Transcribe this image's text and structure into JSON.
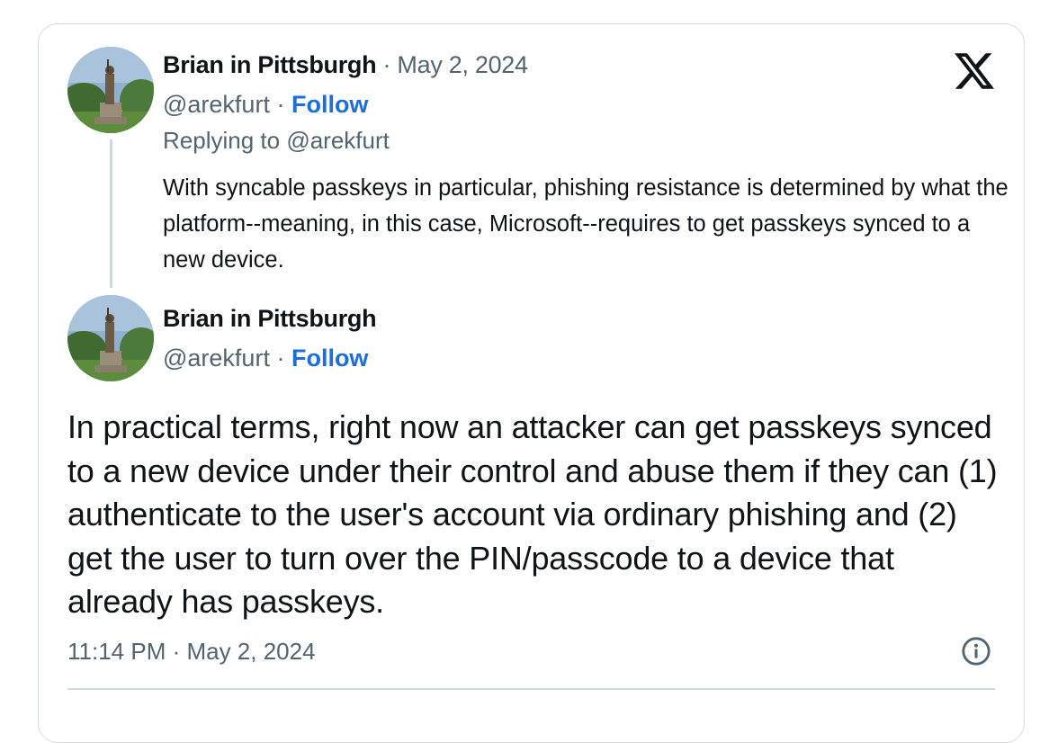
{
  "parent_tweet": {
    "author_name": "Brian in Pittsburgh",
    "date_separator": " · ",
    "date": "May 2, 2024",
    "handle": "@arekfurt",
    "handle_separator": " · ",
    "follow_label": "Follow",
    "replying_prefix": "Replying to ",
    "replying_handle": "@arekfurt",
    "text": "With syncable passkeys in particular, phishing resistance is determined by what the platform--meaning, in this case, Microsoft--requires to get passkeys synced to a new device."
  },
  "main_tweet": {
    "author_name": "Brian in Pittsburgh",
    "handle": "@arekfurt",
    "handle_separator": " · ",
    "follow_label": "Follow",
    "text": "In practical terms, right now an attacker can get passkeys synced to a new device under their control and abuse them if they can (1) authenticate to the user's account via ordinary phishing and (2) get the user to turn over the PIN/passcode to a device that already has passkeys.",
    "timestamp": "11:14 PM · May 2, 2024"
  },
  "icons": {
    "brand": "x-logo-icon",
    "info": "info-icon"
  },
  "colors": {
    "follow": "#1d6ed8",
    "muted": "#536471",
    "text": "#0f1419",
    "border": "#d6dbe0"
  }
}
